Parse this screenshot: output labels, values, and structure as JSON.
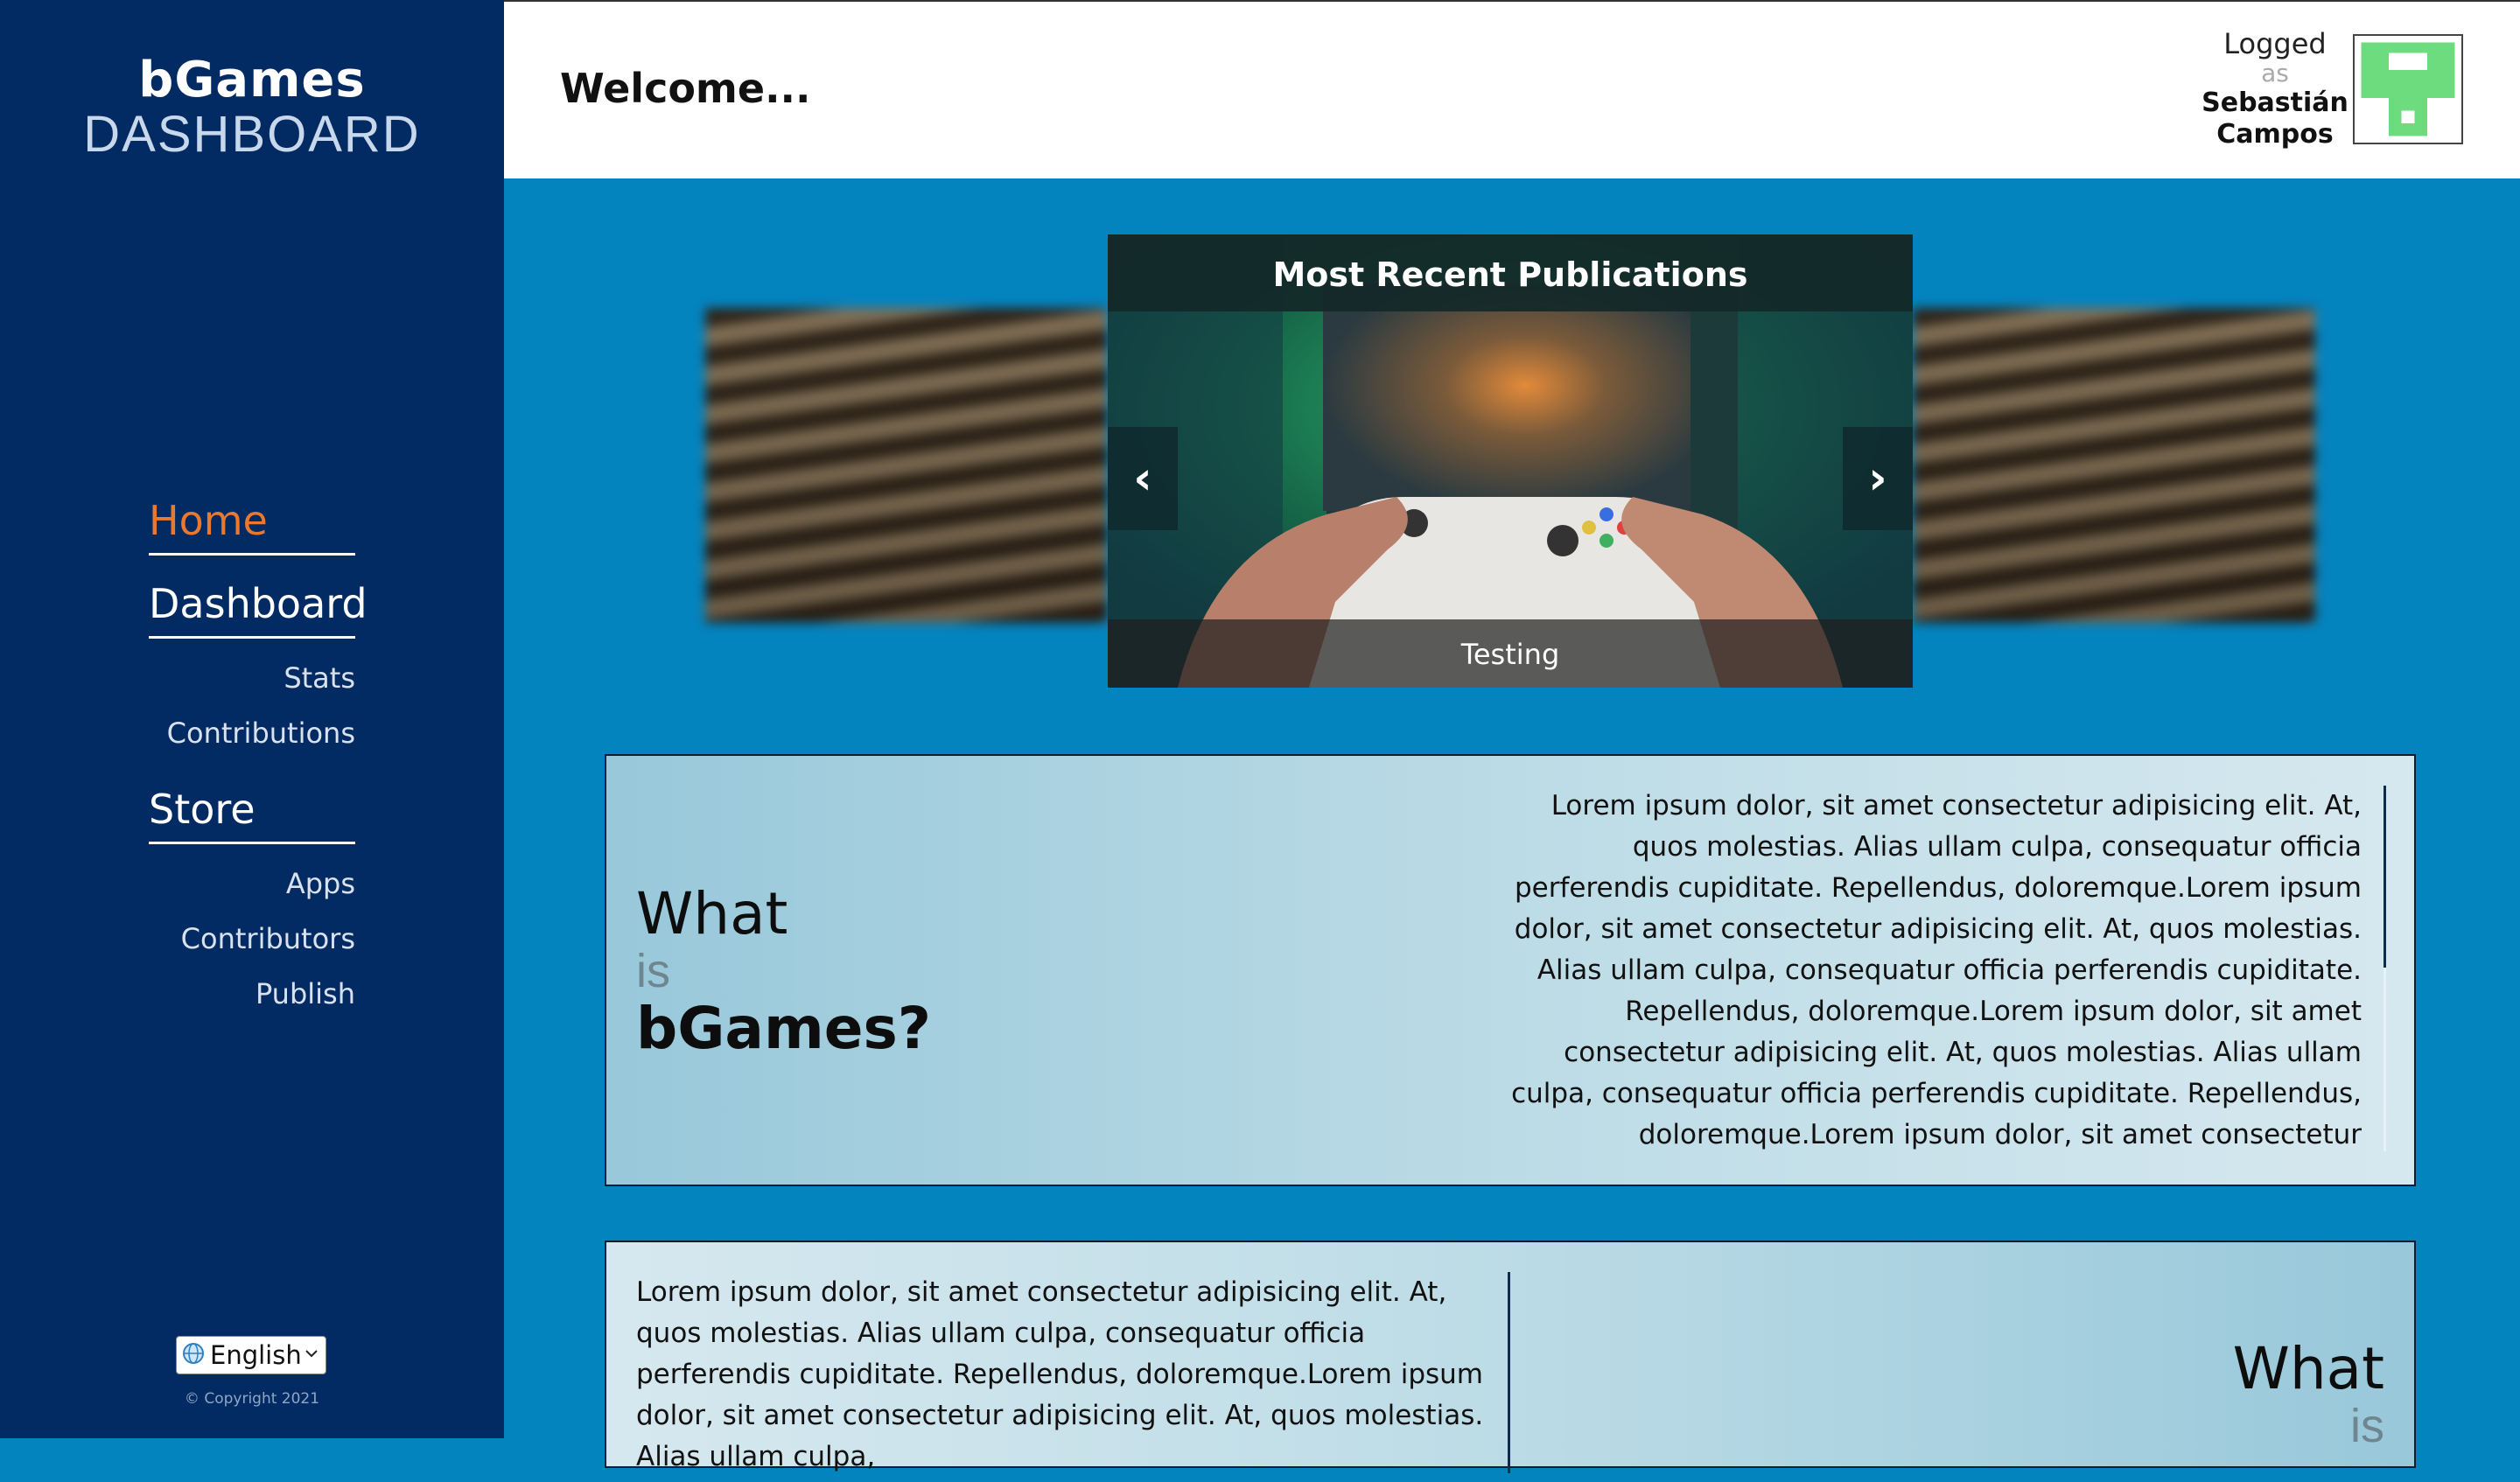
{
  "sidebar": {
    "brand_top": "bGames",
    "brand_bottom": "DASHBOARD",
    "nav": {
      "home": "Home",
      "dashboard": "Dashboard",
      "stats": "Stats",
      "contributions": "Contributions",
      "store": "Store",
      "apps": "Apps",
      "contributors": "Contributors",
      "publish": "Publish"
    },
    "language": "English",
    "copyright": "© Copyright 2021"
  },
  "header": {
    "welcome": "Welcome...",
    "logged": "Logged",
    "as": "as",
    "user_first": "Sebastián",
    "user_last": "Campos"
  },
  "carousel": {
    "title": "Most Recent Publications",
    "caption": "Testing",
    "prev": "‹",
    "next": "›"
  },
  "about": {
    "what": "What",
    "is": "is",
    "bgames": "bGames?",
    "text": "Lorem ipsum dolor, sit amet consectetur adipisicing elit. At, quos molestias. Alias ullam culpa, consequatur officia perferendis cupiditate. Repellendus, doloremque.Lorem ipsum dolor, sit amet consectetur adipisicing elit. At, quos molestias. Alias ullam culpa, consequatur officia perferendis cupiditate. Repellendus, doloremque.Lorem ipsum dolor, sit amet consectetur adipisicing elit. At, quos molestias. Alias ullam culpa, consequatur officia perferendis cupiditate. Repellendus, doloremque.Lorem ipsum dolor, sit amet consectetur adipisicing"
  },
  "about2": {
    "what": "What",
    "is": "is",
    "text": "Lorem ipsum dolor, sit amet consectetur adipisicing elit. At, quos molestias. Alias ullam culpa, consequatur officia perferendis cupiditate. Repellendus, doloremque.Lorem ipsum dolor, sit amet consectetur adipisicing elit. At, quos molestias. Alias ullam culpa,"
  },
  "colors": {
    "sidebar_bg": "#022b63",
    "main_bg": "#0484bf",
    "active_nav": "#e8792e",
    "avatar_green": "#6ddc7e"
  },
  "icons": {
    "language": "globe-icon",
    "dropdown": "chevron-down-icon",
    "avatar": "identicon"
  }
}
